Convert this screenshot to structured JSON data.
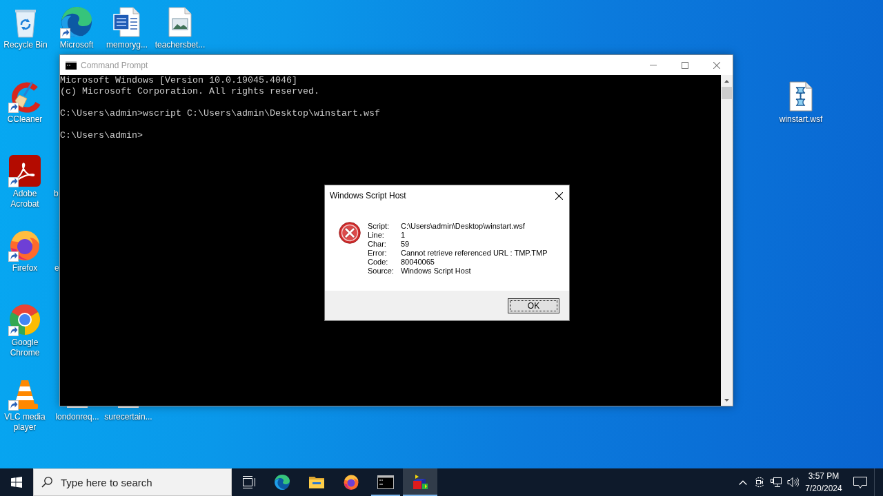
{
  "desktop_icons": [
    {
      "label": "Recycle Bin",
      "kind": "bin",
      "shortcut": false
    },
    {
      "label": "Microsoft",
      "kind": "edge",
      "shortcut": true
    },
    {
      "label": "memoryg...",
      "kind": "word",
      "shortcut": false
    },
    {
      "label": "teachersbet...",
      "kind": "image",
      "shortcut": false
    },
    {
      "label": "winstart.wsf",
      "kind": "script",
      "shortcut": false
    },
    {
      "label": "CCleaner",
      "kind": "ccleaner",
      "shortcut": true
    },
    {
      "label": "Adobe Acrobat",
      "kind": "acrobat",
      "shortcut": true
    },
    {
      "label": "b",
      "kind": "covered"
    },
    {
      "label": "Firefox",
      "kind": "firefox",
      "shortcut": true
    },
    {
      "label": "e",
      "kind": "covered"
    },
    {
      "label": "Google Chrome",
      "kind": "chrome",
      "shortcut": true
    },
    {
      "label": "VLC media player",
      "kind": "vlc",
      "shortcut": true
    },
    {
      "label": "londonreq...",
      "kind": "partial"
    },
    {
      "label": "surecertain...",
      "kind": "partial"
    }
  ],
  "command_prompt": {
    "title": "Command Prompt",
    "active": false,
    "blocks": [
      [
        "Microsoft Windows [Version 10.0.19045.4046]",
        "(c) Microsoft Corporation. All rights reserved."
      ],
      [
        "C:\\Users\\admin>wscript C:\\Users\\admin\\Desktop\\winstart.wsf"
      ],
      [
        "C:\\Users\\admin>"
      ]
    ]
  },
  "dialog": {
    "title": "Windows Script Host",
    "active": true,
    "fields": [
      {
        "label": "Script:",
        "value": "C:\\Users\\admin\\Desktop\\winstart.wsf"
      },
      {
        "label": "Line:",
        "value": "1"
      },
      {
        "label": "Char:",
        "value": "59"
      },
      {
        "label": "Error:",
        "value": "Cannot retrieve referenced URL : TMP.TMP"
      },
      {
        "label": "Code:",
        "value": "80040065"
      },
      {
        "label": "Source:",
        "value": "Windows Script Host"
      }
    ],
    "button": "OK"
  },
  "taskbar": {
    "search": {
      "placeholder": "Type here to search"
    },
    "apps": [
      {
        "kind": "taskview",
        "running": false,
        "selected": false
      },
      {
        "kind": "edge",
        "running": false,
        "selected": false
      },
      {
        "kind": "explorer",
        "running": false,
        "selected": false
      },
      {
        "kind": "firefox",
        "running": false,
        "selected": false
      },
      {
        "kind": "cmd",
        "running": true,
        "selected": false
      },
      {
        "kind": "wsh",
        "running": true,
        "selected": true
      }
    ],
    "clock": {
      "time": "3:57 PM",
      "date": "7/20/2024"
    }
  }
}
